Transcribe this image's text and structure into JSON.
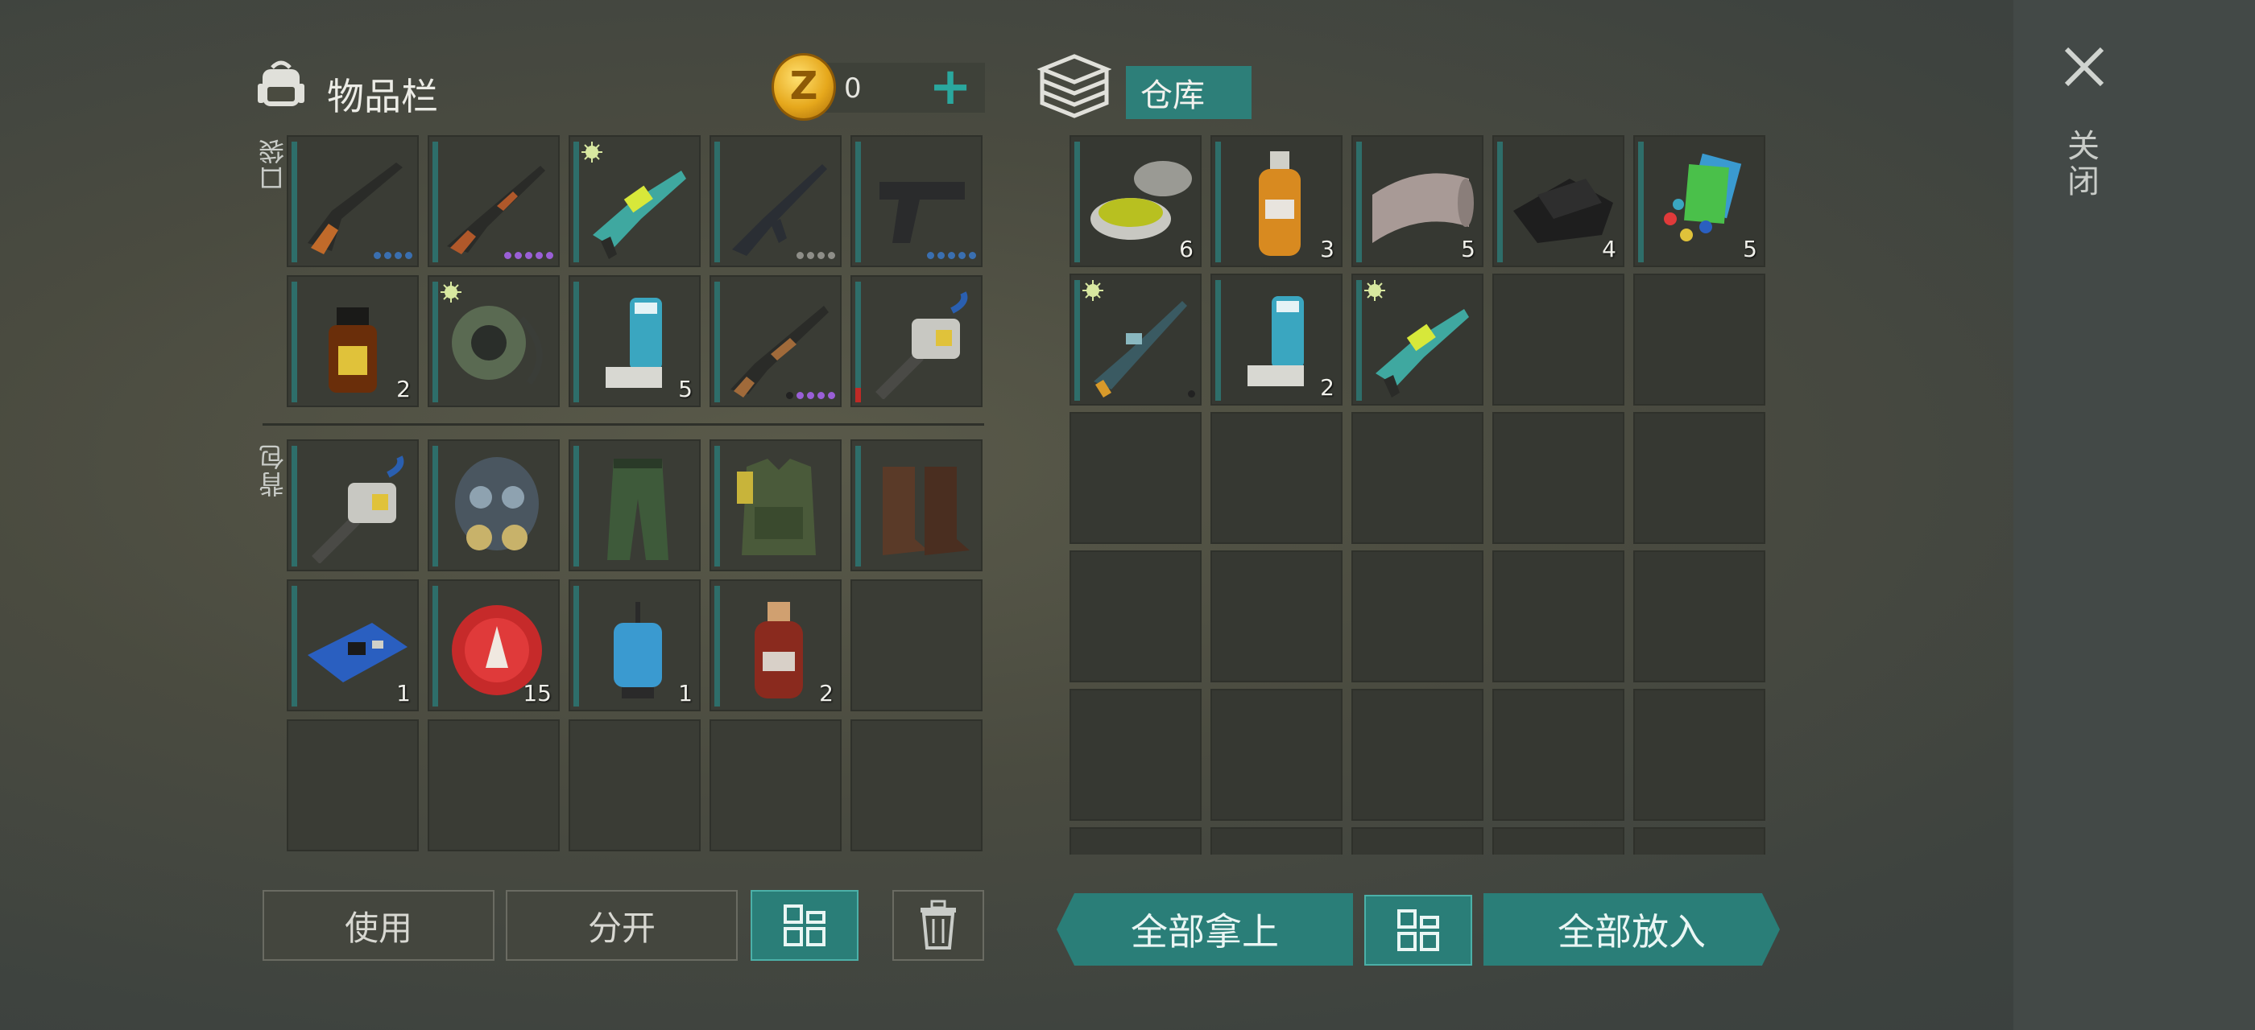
{
  "inventory": {
    "title": "物品栏",
    "coins": "0",
    "coin_symbol": "Z",
    "plus": "+",
    "pocket_label": "口袋",
    "backpack_label": "背包",
    "pocket": [
      {
        "icon": "sniper-rifle-icon",
        "dots": [
          "#3a6fb0",
          "#3a6fb0",
          "#3a6fb0",
          "#3a6fb0"
        ]
      },
      {
        "icon": "ak-rifle-icon",
        "dots": [
          "#9a5fd6",
          "#9a5fd6",
          "#9a5fd6",
          "#9a5fd6",
          "#9a5fd6"
        ]
      },
      {
        "icon": "plasma-rifle-icon",
        "flag": true
      },
      {
        "icon": "assault-rifle-icon",
        "dots": [
          "#8e8e88",
          "#8e8e88",
          "#8e8e88",
          "#8e8e88"
        ]
      },
      {
        "icon": "pistol-icon",
        "dots": [
          "#3a6fb0",
          "#3a6fb0",
          "#3a6fb0",
          "#3a6fb0",
          "#3a6fb0"
        ]
      },
      {
        "icon": "iodine-bottle-icon",
        "count": "2"
      },
      {
        "icon": "respirator-icon",
        "flag": true
      },
      {
        "icon": "inhaler-icon",
        "count": "5"
      },
      {
        "icon": "shotgun-icon",
        "dots": [
          "#222",
          "#9a5fd6",
          "#9a5fd6",
          "#9a5fd6",
          "#9a5fd6"
        ]
      },
      {
        "icon": "drill-icon",
        "red": true
      }
    ],
    "backpack": [
      {
        "icon": "drill-icon"
      },
      {
        "icon": "gas-mask-icon"
      },
      {
        "icon": "camo-pants-icon"
      },
      {
        "icon": "tactical-vest-icon"
      },
      {
        "icon": "leather-boots-icon"
      },
      {
        "icon": "circuit-board-icon",
        "count": "1"
      },
      {
        "icon": "bottle-cap-icon",
        "count": "15"
      },
      {
        "icon": "water-pump-icon",
        "count": "1"
      },
      {
        "icon": "spirit-bottle-icon",
        "count": "2"
      },
      {
        "icon": "empty"
      },
      {
        "icon": "empty"
      },
      {
        "icon": "empty"
      },
      {
        "icon": "empty"
      },
      {
        "icon": "empty"
      },
      {
        "icon": "empty"
      }
    ],
    "buttons": {
      "use": "使用",
      "split": "分开"
    }
  },
  "warehouse": {
    "tab": "仓库",
    "items": [
      {
        "icon": "ointment-jar-icon",
        "count": "6"
      },
      {
        "icon": "liquid-bottle-icon",
        "count": "3"
      },
      {
        "icon": "cloth-roll-icon",
        "count": "5"
      },
      {
        "icon": "leather-icon",
        "count": "4"
      },
      {
        "icon": "pills-icon",
        "count": "5"
      },
      {
        "icon": "laser-rifle-icon",
        "flag": true,
        "dots": [
          "#222"
        ]
      },
      {
        "icon": "inhaler-icon",
        "count": "2"
      },
      {
        "icon": "plasma-rifle-icon",
        "flag": true
      }
    ],
    "buttons": {
      "take_all": "全部拿上",
      "put_all": "全部放入"
    }
  },
  "close_label": "关闭",
  "colors": {
    "accent": "#2a7e78",
    "accent_light": "#4bb0a8"
  }
}
